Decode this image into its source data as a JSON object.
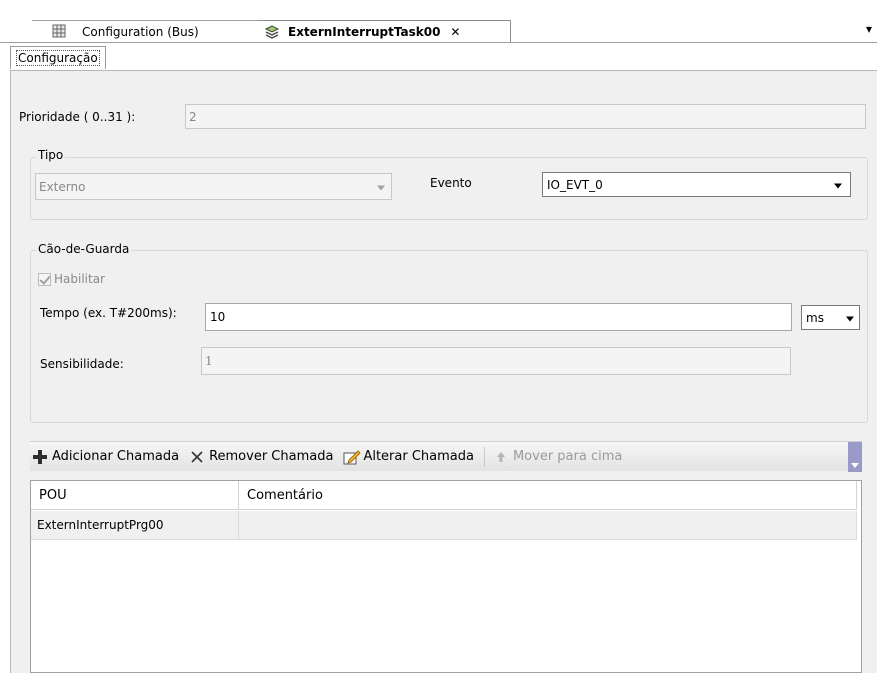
{
  "tabs": {
    "tab1_label": "Configuration (Bus)",
    "tab2_label": "ExternInterruptTask00",
    "close_glyph": "✕",
    "more_glyph": "▾"
  },
  "subtab": {
    "label": "Configuração"
  },
  "priority": {
    "label": "Prioridade ( 0..31 ):",
    "value": "2"
  },
  "tipo": {
    "group_label": "Tipo",
    "type_value": "Externo",
    "event_label": "Evento",
    "event_value": "IO_EVT_0"
  },
  "watchdog": {
    "group_label": "Cão-de-Guarda",
    "enable_label": "Habilitar",
    "enable_checked": true,
    "time_label": "Tempo (ex. T#200ms):",
    "time_value": "10",
    "unit_value": "ms",
    "sensitivity_label": "Sensibilidade:",
    "sensitivity_value": "1"
  },
  "toolbar": {
    "add_label": "Adicionar Chamada",
    "remove_label": "Remover Chamada",
    "edit_label": "Alterar Chamada",
    "moveup_label": "Mover para cima"
  },
  "table": {
    "headers": [
      "POU",
      "Comentário"
    ],
    "rows": [
      {
        "pou": "ExternInterruptPrg00",
        "comment": ""
      }
    ]
  }
}
